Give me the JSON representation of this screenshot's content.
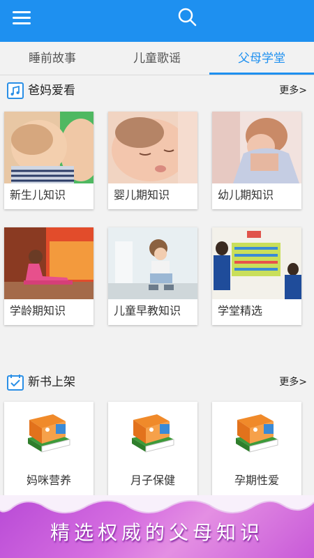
{
  "header": {
    "menu_icon": "hamburger-menu-icon",
    "search_icon": "search-icon",
    "bg_color": "#1e90f0"
  },
  "tabs": [
    {
      "label": "睡前故事",
      "active": false
    },
    {
      "label": "儿童歌谣",
      "active": false
    },
    {
      "label": "父母学堂",
      "active": true
    }
  ],
  "section_parents": {
    "icon": "music-note-icon",
    "title": "爸妈爱看",
    "more": "更多>",
    "items": [
      {
        "label": "新生儿知识",
        "image": "nursing-baby-photo"
      },
      {
        "label": "婴儿期知识",
        "image": "sleeping-newborn-photo"
      },
      {
        "label": "幼儿期知识",
        "image": "crying-child-photo"
      },
      {
        "label": "学龄期知识",
        "image": "stretching-girl-photo"
      },
      {
        "label": "儿童早教知识",
        "image": "shoe-tying-girl-photo"
      },
      {
        "label": "学堂精选",
        "image": "classroom-teachers-photo"
      }
    ]
  },
  "section_books": {
    "icon": "calendar-check-icon",
    "title": "新书上架",
    "more": "更多>",
    "items": [
      {
        "label": "妈咪营养",
        "image": "book-stack-icon"
      },
      {
        "label": "月子保健",
        "image": "book-stack-icon"
      },
      {
        "label": "孕期性爱",
        "image": "book-stack-icon"
      }
    ]
  },
  "banner": {
    "text": "精选权威的父母知识"
  }
}
